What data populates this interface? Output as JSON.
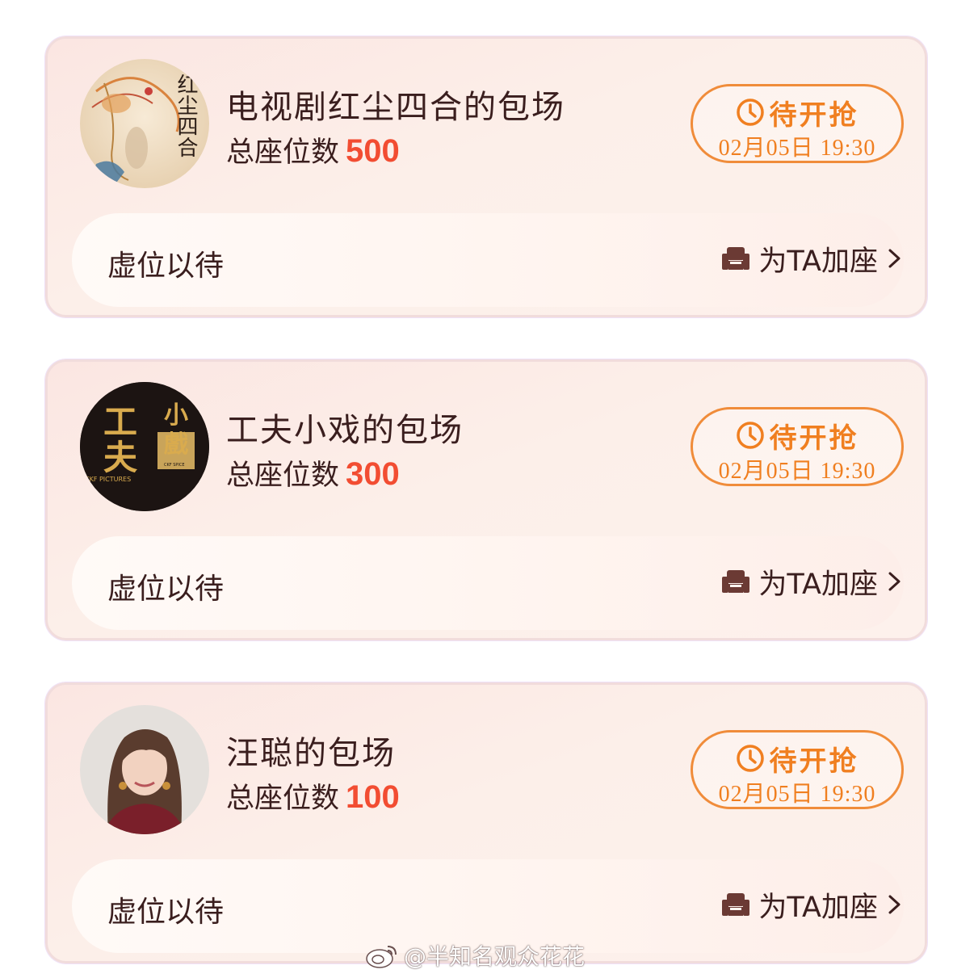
{
  "cards": [
    {
      "title": "电视剧红尘四合的包场",
      "seats_label": "总座位数",
      "seats_value": "500",
      "grab_label": "待开抢",
      "grab_time": "02月05日 19:30",
      "bar_text": "虚位以待",
      "add_seat_label": "为TA加座",
      "avatar_text": "红尘四合"
    },
    {
      "title": "工夫小戏的包场",
      "seats_label": "总座位数",
      "seats_value": "300",
      "grab_label": "待开抢",
      "grab_time": "02月05日 19:30",
      "bar_text": "虚位以待",
      "add_seat_label": "为TA加座",
      "avatar_text": "工夫",
      "avatar_text2": "小戲",
      "avatar_small": "CKF PICTURES",
      "avatar_small2": "CKF SPICE"
    },
    {
      "title": "汪聪的包场",
      "seats_label": "总座位数",
      "seats_value": "100",
      "grab_label": "待开抢",
      "grab_time": "02月05日 19:30",
      "bar_text": "虚位以待",
      "add_seat_label": "为TA加座"
    }
  ],
  "watermark": "@半知名观众花花",
  "colors": {
    "accent_orange": "#f08c3a",
    "seat_red": "#f24d32",
    "text_dark": "#3a1e1e"
  },
  "icons": [
    "clock-icon",
    "sofa-icon",
    "chevron-right-icon",
    "weibo-icon"
  ]
}
